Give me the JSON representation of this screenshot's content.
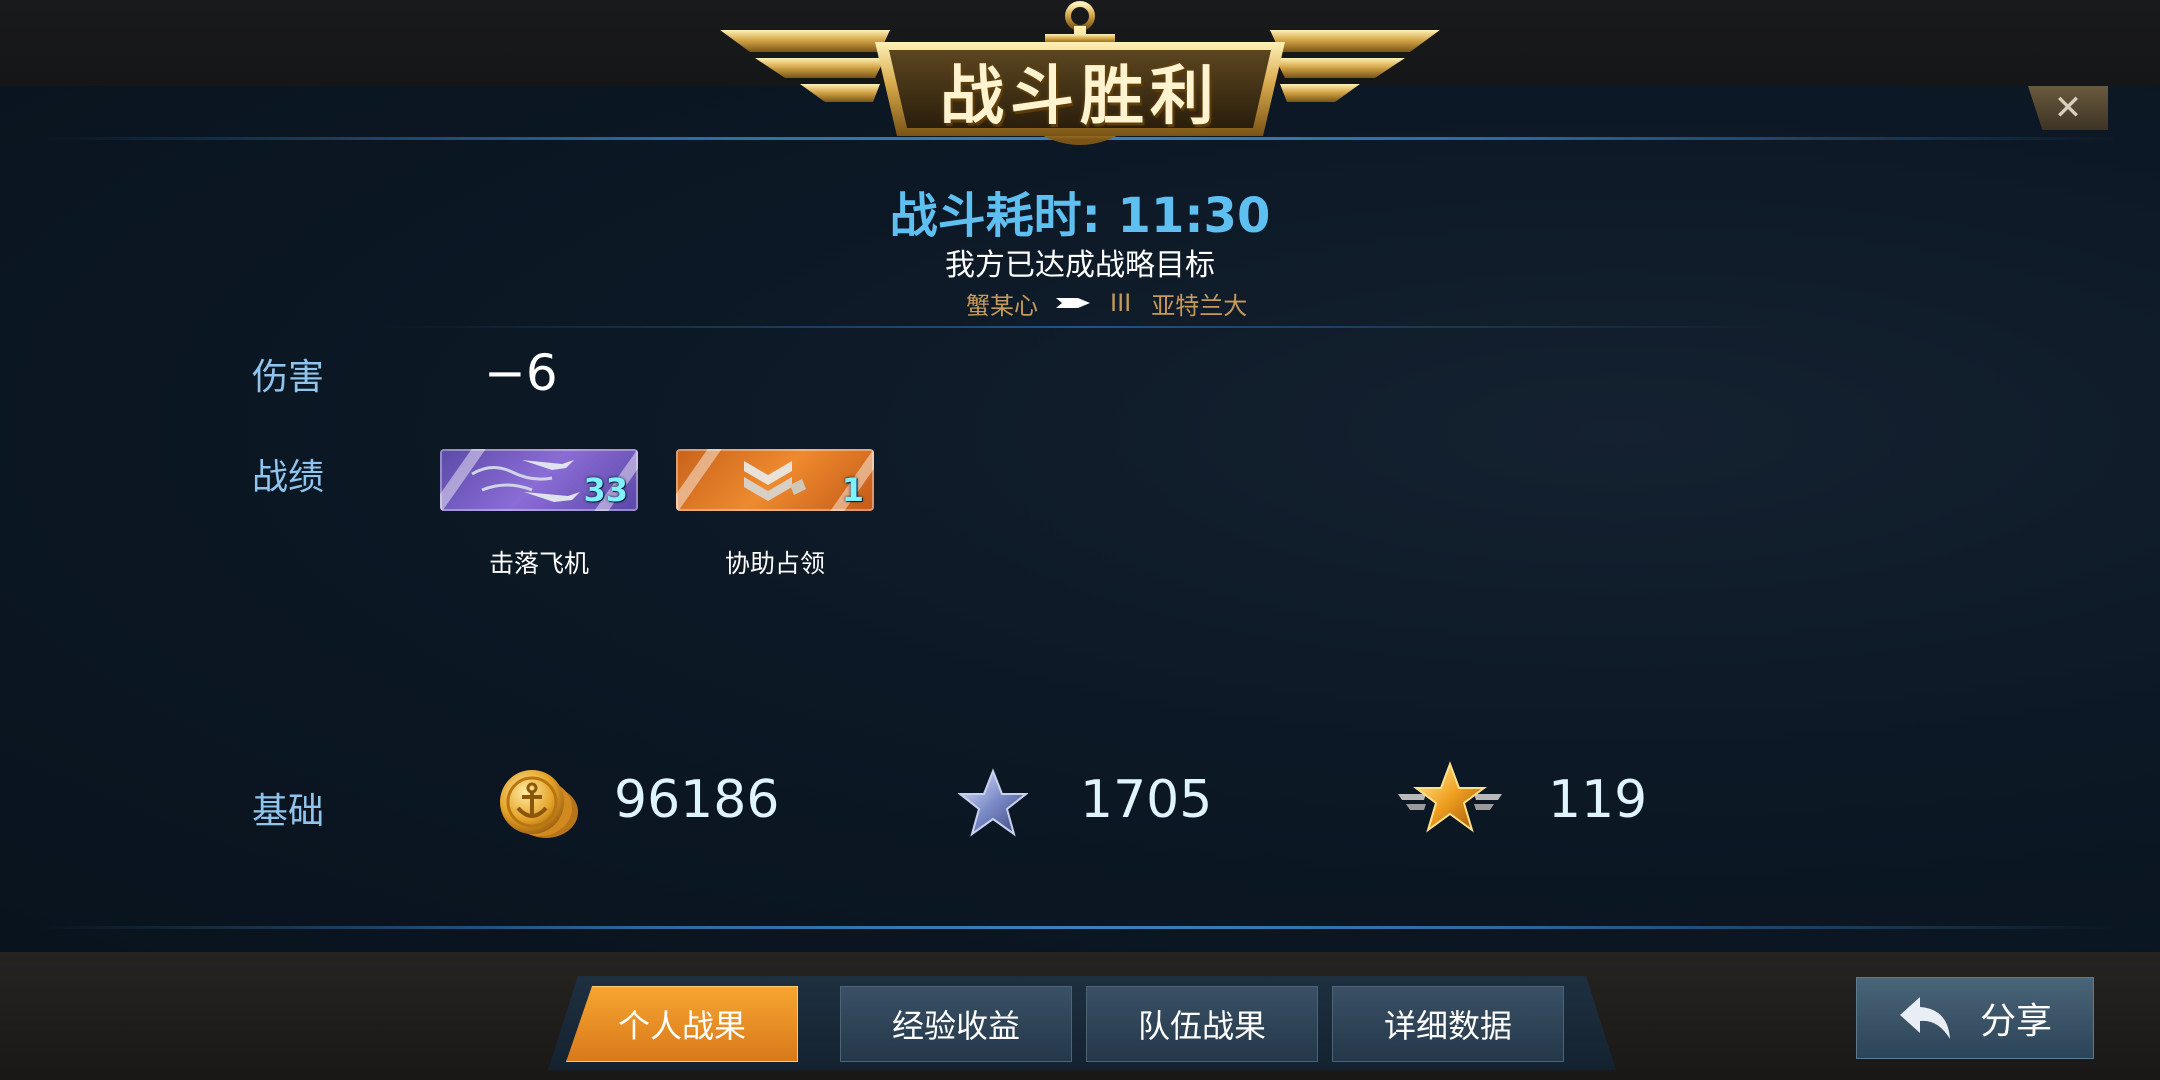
{
  "header": {
    "title": "战斗胜利",
    "close_label": "✕"
  },
  "battle": {
    "time_label": "战斗耗时: 11:30",
    "objective": "我方已达成战略目标",
    "player_left": "蟹某心",
    "separator": "III",
    "player_right": "亚特兰大"
  },
  "damage": {
    "label": "伤害",
    "value": "−6"
  },
  "record": {
    "label": "战绩",
    "medals": [
      {
        "count": "33",
        "caption": "击落飞机",
        "icon": "planes-icon"
      },
      {
        "count": "1",
        "caption": "协助占领",
        "icon": "chevron-rank-icon"
      }
    ]
  },
  "base": {
    "label": "基础",
    "items": [
      {
        "icon": "gold-coin-icon",
        "value": "96186"
      },
      {
        "icon": "silver-star-icon",
        "value": "1705"
      },
      {
        "icon": "gold-star-wings-icon",
        "value": "119"
      }
    ]
  },
  "tabs": [
    {
      "label": "个人战果",
      "active": true
    },
    {
      "label": "经验收益",
      "active": false
    },
    {
      "label": "队伍战果",
      "active": false
    },
    {
      "label": "详细数据",
      "active": false
    }
  ],
  "share": {
    "label": "分享"
  },
  "colors": {
    "accent_blue": "#5ec0f0",
    "gold": "#c89a58",
    "tab_active": "#f09a2a"
  }
}
